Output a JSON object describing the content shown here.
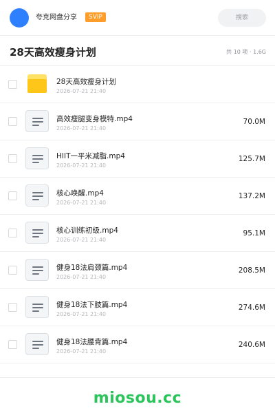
{
  "header": {
    "brand": "夸克网盘分享",
    "badge": "SVIP",
    "search_placeholder": "搜索"
  },
  "title_bar": {
    "title": "28天高效瘦身计划",
    "summary": "共 10 项 · 1.6G"
  },
  "files": [
    {
      "type": "folder",
      "icon": "folder-icon",
      "name": "28天高效瘦身计划",
      "date": "2026-07-21 21:40",
      "size": ""
    },
    {
      "type": "file",
      "icon": "document-icon",
      "name": "高效瘦腿变身模特.mp4",
      "date": "2026-07-21 21:40",
      "size": "70.0M"
    },
    {
      "type": "file",
      "icon": "document-icon",
      "name": "HIIT一平米减脂.mp4",
      "date": "2026-07-21 21:40",
      "size": "125.7M"
    },
    {
      "type": "file",
      "icon": "document-icon",
      "name": "核心唤醒.mp4",
      "date": "2026-07-21 21:40",
      "size": "137.2M"
    },
    {
      "type": "file",
      "icon": "document-icon",
      "name": "核心训练初级.mp4",
      "date": "2026-07-21 21:40",
      "size": "95.1M"
    },
    {
      "type": "file",
      "icon": "document-icon",
      "name": "健身18法肩颈篇.mp4",
      "date": "2026-07-21 21:40",
      "size": "208.5M"
    },
    {
      "type": "file",
      "icon": "document-icon",
      "name": "健身18法下肢篇.mp4",
      "date": "2026-07-21 21:40",
      "size": "274.6M"
    },
    {
      "type": "file",
      "icon": "document-icon",
      "name": "健身18法腰背篇.mp4",
      "date": "2026-07-21 21:40",
      "size": "240.6M"
    }
  ],
  "watermark": "miosou.cc",
  "colors": {
    "accent_blue": "#2f80ff",
    "badge_orange": "#ff9d2a",
    "folder_yellow": "#ffc61a",
    "watermark_green": "#2bc45a"
  }
}
